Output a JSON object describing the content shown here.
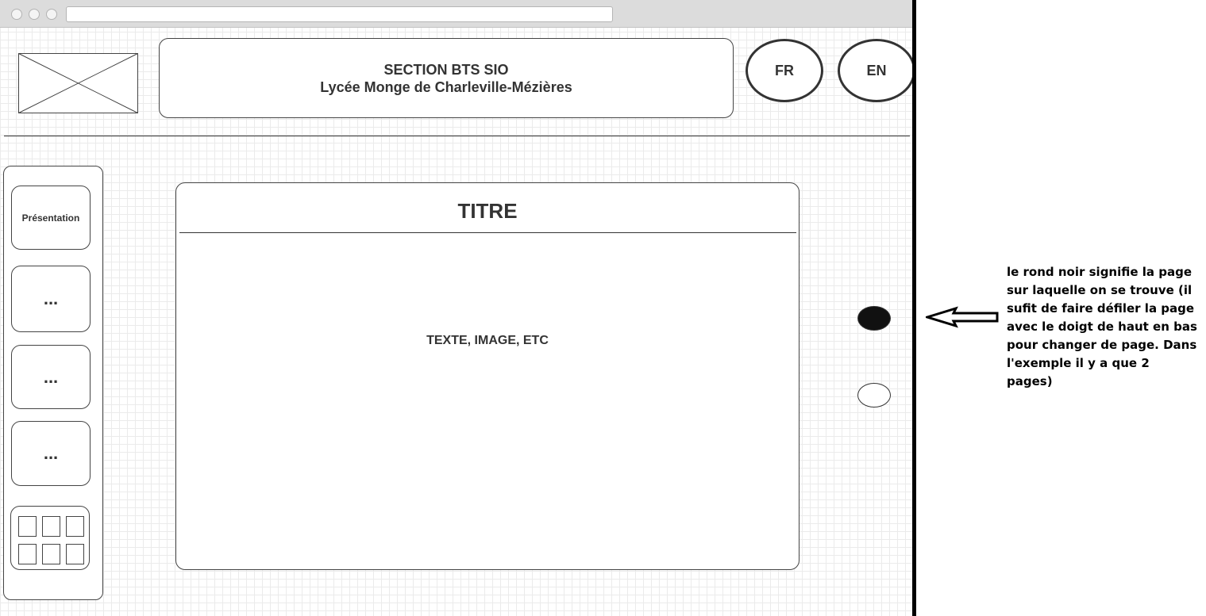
{
  "header": {
    "title_line1": "SECTION BTS SIO",
    "title_line2": "Lycée Monge de Charleville-Mézières"
  },
  "language": {
    "fr_label": "FR",
    "en_label": "EN"
  },
  "sidebar": {
    "items": [
      {
        "label": "Présentation"
      },
      {
        "label": "..."
      },
      {
        "label": "..."
      },
      {
        "label": "..."
      }
    ]
  },
  "content": {
    "title": "TITRE",
    "body": "TEXTE, IMAGE, ETC"
  },
  "pagination": {
    "total_pages": 2,
    "current_page": 1
  },
  "annotation": {
    "text": "le rond noir signifie la page sur laquelle on se trouve (il sufit de faire défiler la page avec le doigt de haut en bas pour changer de page. Dans l'exemple il y a que 2 pages)"
  },
  "colors": {
    "stroke": "#333333",
    "active_dot": "#111111",
    "grid": "#ebebeb"
  }
}
